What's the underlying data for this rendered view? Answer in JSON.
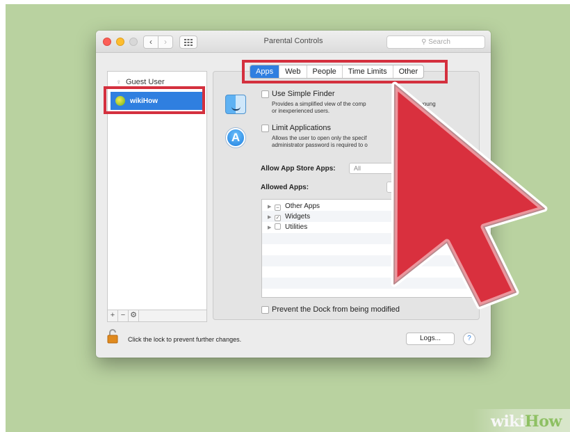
{
  "window": {
    "title": "Parental Controls",
    "search_placeholder": "Search"
  },
  "users": {
    "guest": "Guest User",
    "selected": "wikiHow"
  },
  "list_tools": [
    "+",
    "−",
    "⚙"
  ],
  "tabs": [
    "Apps",
    "Web",
    "People",
    "Time Limits",
    "Other"
  ],
  "active_tab": "Apps",
  "options": {
    "simple_finder": {
      "label": "Use Simple Finder",
      "desc_line1": "Provides a simplified view of the comp",
      "desc_suffix1": "p for young",
      "desc_line2": "or inexperienced users."
    },
    "limit_apps": {
      "label": "Limit Applications",
      "desc_line1": "Allows the user to open only the specif",
      "desc_line2": "administrator password is required to o"
    }
  },
  "app_store": {
    "label": "Allow App Store Apps:",
    "value": "All"
  },
  "allowed_apps": {
    "label": "Allowed Apps:",
    "rows": [
      "Other Apps",
      "Widgets",
      "Utilities"
    ],
    "row_marks": [
      "–",
      "✓",
      ""
    ]
  },
  "prevent_dock": "Prevent the Dock from being modified",
  "footer": {
    "lock_text": "Click the lock to prevent further changes.",
    "logs_button": "Logs...",
    "help_button": "?"
  },
  "watermark": {
    "part1": "wiki",
    "part2": "How"
  },
  "colors": {
    "background": "#b9d2a0",
    "selection": "#2f7fe0",
    "annotation_red": "#d4303e"
  }
}
